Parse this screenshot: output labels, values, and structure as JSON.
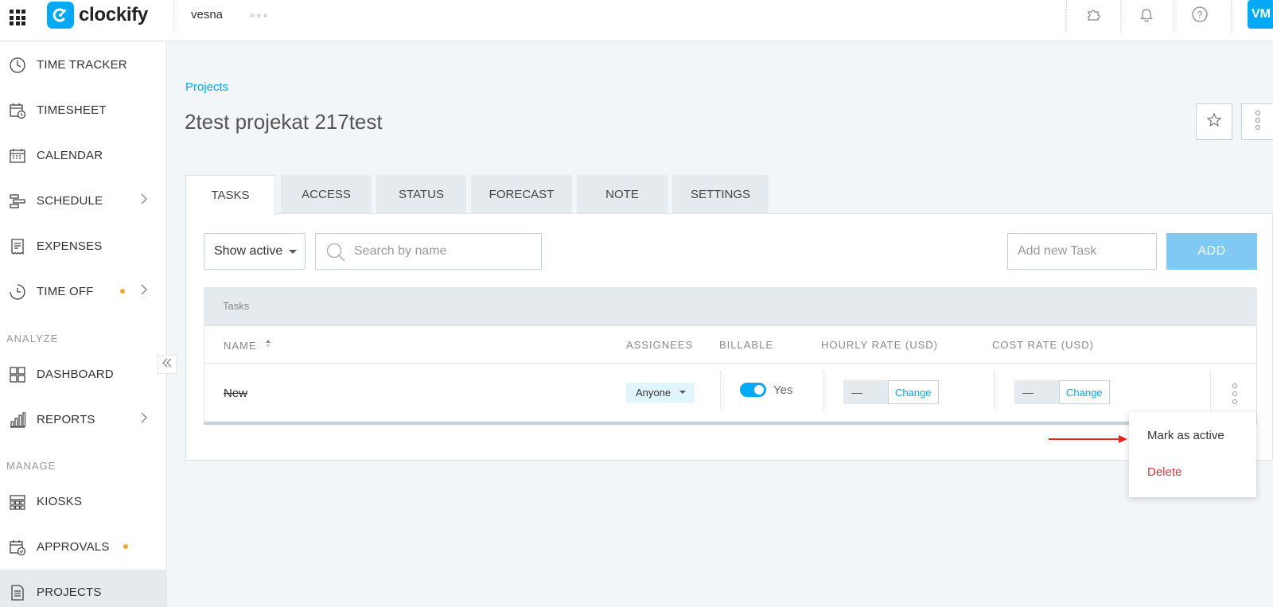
{
  "topbar": {
    "logo_text": "clockify",
    "workspace": "vesna",
    "more": "∘∘∘",
    "avatar": "VM"
  },
  "sidebar": {
    "items": [
      {
        "label": "TIME TRACKER",
        "icon": "clock-icon"
      },
      {
        "label": "TIMESHEET",
        "icon": "timesheet-icon"
      },
      {
        "label": "CALENDAR",
        "icon": "calendar-icon"
      },
      {
        "label": "SCHEDULE",
        "icon": "schedule-icon"
      },
      {
        "label": "EXPENSES",
        "icon": "receipt-icon"
      },
      {
        "label": "TIME OFF",
        "icon": "time-off-icon"
      },
      {
        "label": "DASHBOARD",
        "icon": "dashboard-icon"
      },
      {
        "label": "REPORTS",
        "icon": "reports-icon"
      },
      {
        "label": "KIOSKS",
        "icon": "kiosk-icon"
      },
      {
        "label": "APPROVALS",
        "icon": "approvals-icon"
      },
      {
        "label": "PROJECTS",
        "icon": "projects-icon"
      }
    ],
    "sections": {
      "analyze": "ANALYZE",
      "manage": "MANAGE"
    }
  },
  "main": {
    "breadcrumb": "Projects",
    "title": "2test projekat 217test",
    "tabs": [
      {
        "label": "TASKS",
        "active": true
      },
      {
        "label": "ACCESS"
      },
      {
        "label": "STATUS"
      },
      {
        "label": "FORECAST"
      },
      {
        "label": "NOTE"
      },
      {
        "label": "SETTINGS"
      }
    ],
    "filter": {
      "value": "Show active"
    },
    "search": {
      "placeholder": "Search by name"
    },
    "add_task": {
      "placeholder": "Add new Task",
      "button": "ADD"
    },
    "table": {
      "section_label": "Tasks",
      "columns": [
        "NAME",
        "ASSIGNEES",
        "BILLABLE",
        "HOURLY RATE (USD)",
        "COST RATE (USD)"
      ],
      "rows": [
        {
          "name": "New",
          "assignees": "Anyone",
          "billable": "Yes",
          "hourly_rate": "—",
          "cost_rate": "—",
          "change": "Change"
        }
      ]
    },
    "context_menu": {
      "mark_active": "Mark as active",
      "delete": "Delete"
    }
  },
  "colors": {
    "accent": "#03a9f4",
    "delete": "#e53935",
    "annotation_arrow": "#e8241a",
    "warning_dot": "#f6a623"
  }
}
